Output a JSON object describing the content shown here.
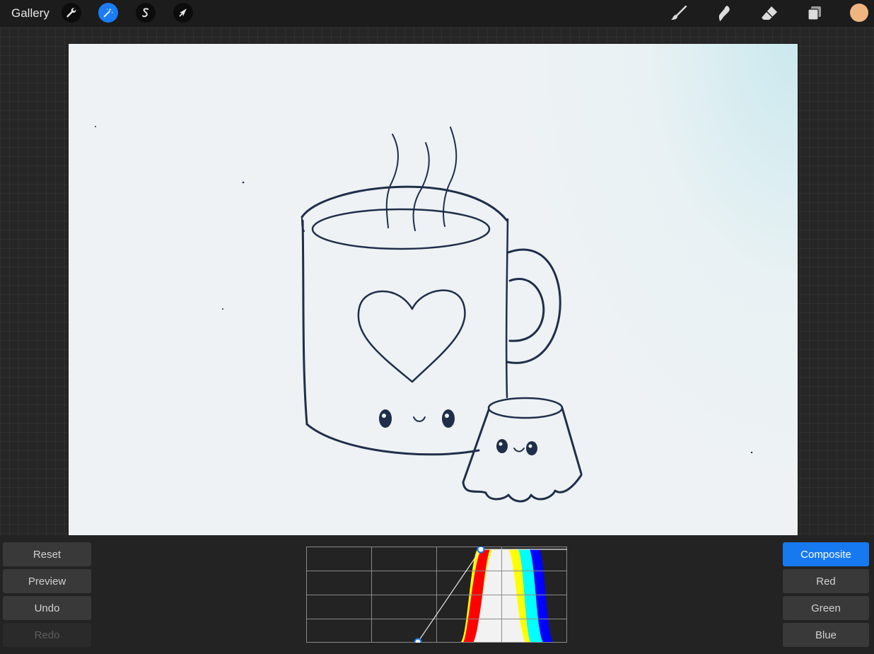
{
  "topbar": {
    "gallery_label": "Gallery",
    "left_tools": [
      {
        "icon": "wrench-icon",
        "active": false
      },
      {
        "icon": "magic-wand-icon",
        "active": true
      },
      {
        "icon": "selection-s-icon",
        "active": false
      },
      {
        "icon": "arrow-cursor-icon",
        "active": false
      }
    ],
    "right_tools": [
      "brush-icon",
      "smudge-icon",
      "eraser-icon",
      "layers-icon"
    ],
    "current_color": "#f0b47e"
  },
  "curves": {
    "left_buttons": {
      "reset": "Reset",
      "preview": "Preview",
      "undo": "Undo",
      "redo": "Redo"
    },
    "channels": {
      "composite": "Composite",
      "red": "Red",
      "green": "Green",
      "blue": "Blue"
    },
    "selected_channel": "Composite",
    "accent": "#1679f0",
    "histogram_colors": [
      "#ff0000",
      "#ffff00",
      "#00ffff",
      "#0000ff",
      "#f2f2f2"
    ]
  },
  "canvas": {
    "background": "#eef2f4",
    "stroke": "#1f2e4a"
  }
}
